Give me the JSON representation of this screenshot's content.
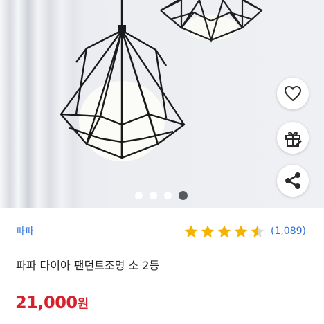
{
  "product": {
    "seller": "파파",
    "title": "파파 다이아 팬던트조명 소 2등",
    "price": "21,000",
    "price_unit": "원"
  },
  "rating": {
    "stars": 4.5,
    "max": 5,
    "review_count": "(1,089)",
    "star_color": "#f5b301"
  },
  "image_carousel": {
    "total": 4,
    "active_index": 3
  },
  "actions": {
    "like_icon": "heart-icon",
    "gift_icon": "gift-icon",
    "share_icon": "share-icon"
  },
  "colors": {
    "seller_link": "#2f6fd6",
    "price": "#d8202c",
    "active_dot": "#555a61"
  }
}
